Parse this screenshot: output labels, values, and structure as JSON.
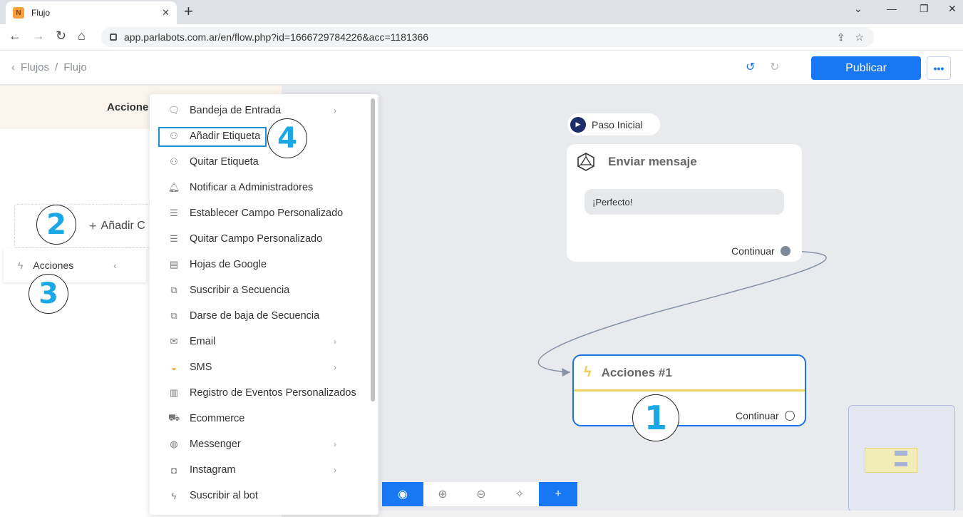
{
  "browser": {
    "tab_title": "Flujo",
    "favicon_letter": "N",
    "url": "app.parlabots.com.ar/en/flow.php?id=1666729784226&acc=1181366"
  },
  "header": {
    "breadcrumb_root": "Flujos",
    "breadcrumb_sep": "/",
    "breadcrumb_current": "Flujo",
    "publish_label": "Publicar",
    "more_label": "•••"
  },
  "left_panel": {
    "title": "Accione",
    "add_condition_label": "Añadir C",
    "acciones_label": "Acciones"
  },
  "canvas": {
    "start_label": "Paso Inicial",
    "message_node": {
      "title": "Enviar mensaje",
      "bubble_text": "¡Perfecto!",
      "continue_label": "Continuar"
    },
    "action_node": {
      "title": "Acciones #1",
      "continue_label": "Continuar"
    }
  },
  "menu": {
    "items": [
      {
        "label": "Bandeja de Entrada",
        "icon": "chat-icon",
        "submenu": true
      },
      {
        "label": "Añadir Etiqueta",
        "icon": "user-tag-icon",
        "submenu": false
      },
      {
        "label": "Quitar Etiqueta",
        "icon": "user-tag-icon",
        "submenu": false
      },
      {
        "label": "Notificar a Administradores",
        "icon": "bell-icon",
        "submenu": false
      },
      {
        "label": "Establecer Campo Personalizado",
        "icon": "database-icon",
        "submenu": false
      },
      {
        "label": "Quitar Campo Personalizado",
        "icon": "database-icon",
        "submenu": false
      },
      {
        "label": "Hojas de Google",
        "icon": "sheet-icon",
        "submenu": false
      },
      {
        "label": "Suscribir a Secuencia",
        "icon": "layers-icon",
        "submenu": false
      },
      {
        "label": "Darse de baja de Secuencia",
        "icon": "layers-icon",
        "submenu": false
      },
      {
        "label": "Email",
        "icon": "mail-icon",
        "submenu": true
      },
      {
        "label": "SMS",
        "icon": "sms-icon",
        "submenu": true
      },
      {
        "label": "Registro de Eventos Personalizados",
        "icon": "chart-icon",
        "submenu": false
      },
      {
        "label": "Ecommerce",
        "icon": "cart-icon",
        "submenu": false
      },
      {
        "label": "Messenger",
        "icon": "messenger-icon",
        "submenu": true
      },
      {
        "label": "Instagram",
        "icon": "instagram-icon",
        "submenu": true
      },
      {
        "label": "Suscribir al bot",
        "icon": "bolt-icon",
        "submenu": false
      }
    ]
  },
  "annotations": {
    "one": "1",
    "two": "2",
    "three": "3",
    "four": "4"
  },
  "colors": {
    "accent": "#1877f2",
    "callout_text": "#1aa7e6",
    "action_separator": "#f2d15c"
  }
}
